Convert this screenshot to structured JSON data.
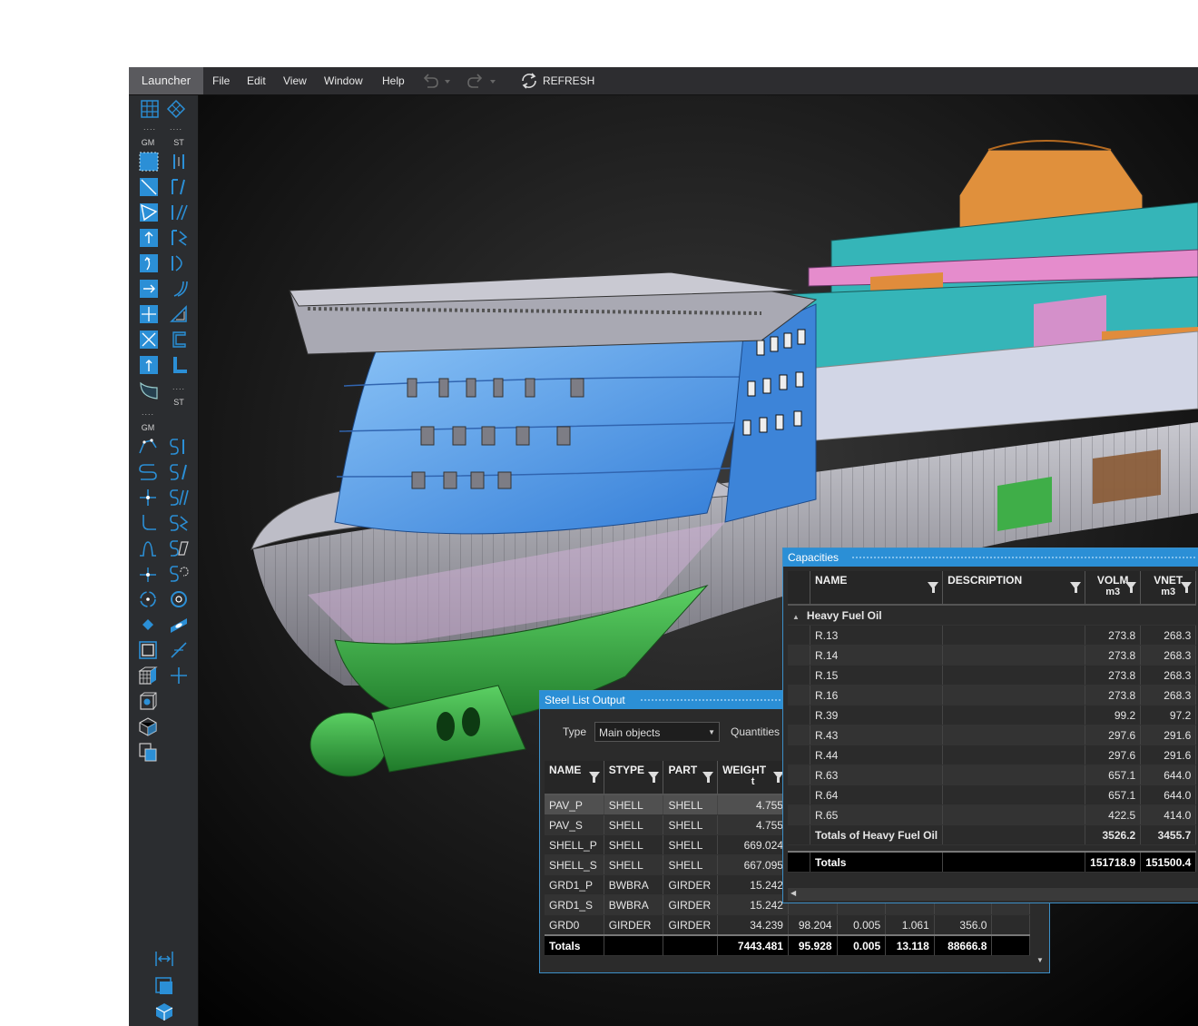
{
  "menu": {
    "launcher": "Launcher",
    "items": [
      "File",
      "Edit",
      "View",
      "Window",
      "Help"
    ],
    "refresh": "REFRESH"
  },
  "toolbar": {
    "gm1": "GM",
    "st1": "ST",
    "st2": "ST",
    "gm2": "GM",
    "dots": "....",
    "accent": "#2b8fd6"
  },
  "capacities": {
    "title": "Capacities",
    "columns": {
      "name": "NAME",
      "description": "DESCRIPTION",
      "volm": "VOLM",
      "volm_unit": "m3",
      "vnet": "VNET",
      "vnet_unit": "m3"
    },
    "group": "Heavy Fuel Oil",
    "rows": [
      {
        "name": "R.13",
        "description": "",
        "volm": "273.8",
        "vnet": "268.3"
      },
      {
        "name": "R.14",
        "description": "",
        "volm": "273.8",
        "vnet": "268.3"
      },
      {
        "name": "R.15",
        "description": "",
        "volm": "273.8",
        "vnet": "268.3"
      },
      {
        "name": "R.16",
        "description": "",
        "volm": "273.8",
        "vnet": "268.3"
      },
      {
        "name": "R.39",
        "description": "",
        "volm": "99.2",
        "vnet": "97.2"
      },
      {
        "name": "R.43",
        "description": "",
        "volm": "297.6",
        "vnet": "291.6"
      },
      {
        "name": "R.44",
        "description": "",
        "volm": "297.6",
        "vnet": "291.6"
      },
      {
        "name": "R.63",
        "description": "",
        "volm": "657.1",
        "vnet": "644.0"
      },
      {
        "name": "R.64",
        "description": "",
        "volm": "657.1",
        "vnet": "644.0"
      },
      {
        "name": "R.65",
        "description": "",
        "volm": "422.5",
        "vnet": "414.0"
      }
    ],
    "group_totals": {
      "label": "Totals of Heavy Fuel Oil",
      "volm": "3526.2",
      "vnet": "3455.7"
    },
    "totals": {
      "label": "Totals",
      "volm": "151718.9",
      "vnet": "151500.4"
    }
  },
  "steel_list": {
    "title": "Steel List Output",
    "type_label": "Type",
    "type_value": "Main objects",
    "quantities_label": "Quantities",
    "columns": {
      "name": "NAME",
      "stype": "STYPE",
      "part": "PART",
      "weight": "WEIGHT",
      "weight_unit": "t"
    },
    "rows": [
      {
        "name": "PAV_P",
        "stype": "SHELL",
        "part": "SHELL",
        "weight": "4.755",
        "c5": "",
        "c6": "",
        "c7": "",
        "c8": ""
      },
      {
        "name": "PAV_S",
        "stype": "SHELL",
        "part": "SHELL",
        "weight": "4.755",
        "c5": "",
        "c6": "",
        "c7": "",
        "c8": ""
      },
      {
        "name": "SHELL_P",
        "stype": "SHELL",
        "part": "SHELL",
        "weight": "669.024",
        "c5": "",
        "c6": "",
        "c7": "",
        "c8": ""
      },
      {
        "name": "SHELL_S",
        "stype": "SHELL",
        "part": "SHELL",
        "weight": "667.095",
        "c5": "",
        "c6": "",
        "c7": "",
        "c8": ""
      },
      {
        "name": "GRD1_P",
        "stype": "BWBRA",
        "part": "GIRDER",
        "weight": "15.242",
        "c5": "",
        "c6": "",
        "c7": "",
        "c8": ""
      },
      {
        "name": "GRD1_S",
        "stype": "BWBRA",
        "part": "GIRDER",
        "weight": "15.242",
        "c5": "",
        "c6": "",
        "c7": "",
        "c8": ""
      },
      {
        "name": "GRD0",
        "stype": "GIRDER",
        "part": "GIRDER",
        "weight": "34.239",
        "c5": "98.204",
        "c6": "0.005",
        "c7": "1.061",
        "c8": "356.0"
      }
    ],
    "totals": {
      "label": "Totals",
      "weight": "7443.481",
      "c5": "95.928",
      "c6": "0.005",
      "c7": "13.118",
      "c8": "88666.8"
    }
  },
  "colors": {
    "panel_title": "#2b8fd6",
    "hull_shell": "#a8a8b4",
    "hull_bulb": "#3fae48",
    "superstructure": "#35b5b8",
    "funnel": "#e08c3c",
    "glass": "#4f9ee8",
    "pink_deck": "#e08cc8"
  }
}
